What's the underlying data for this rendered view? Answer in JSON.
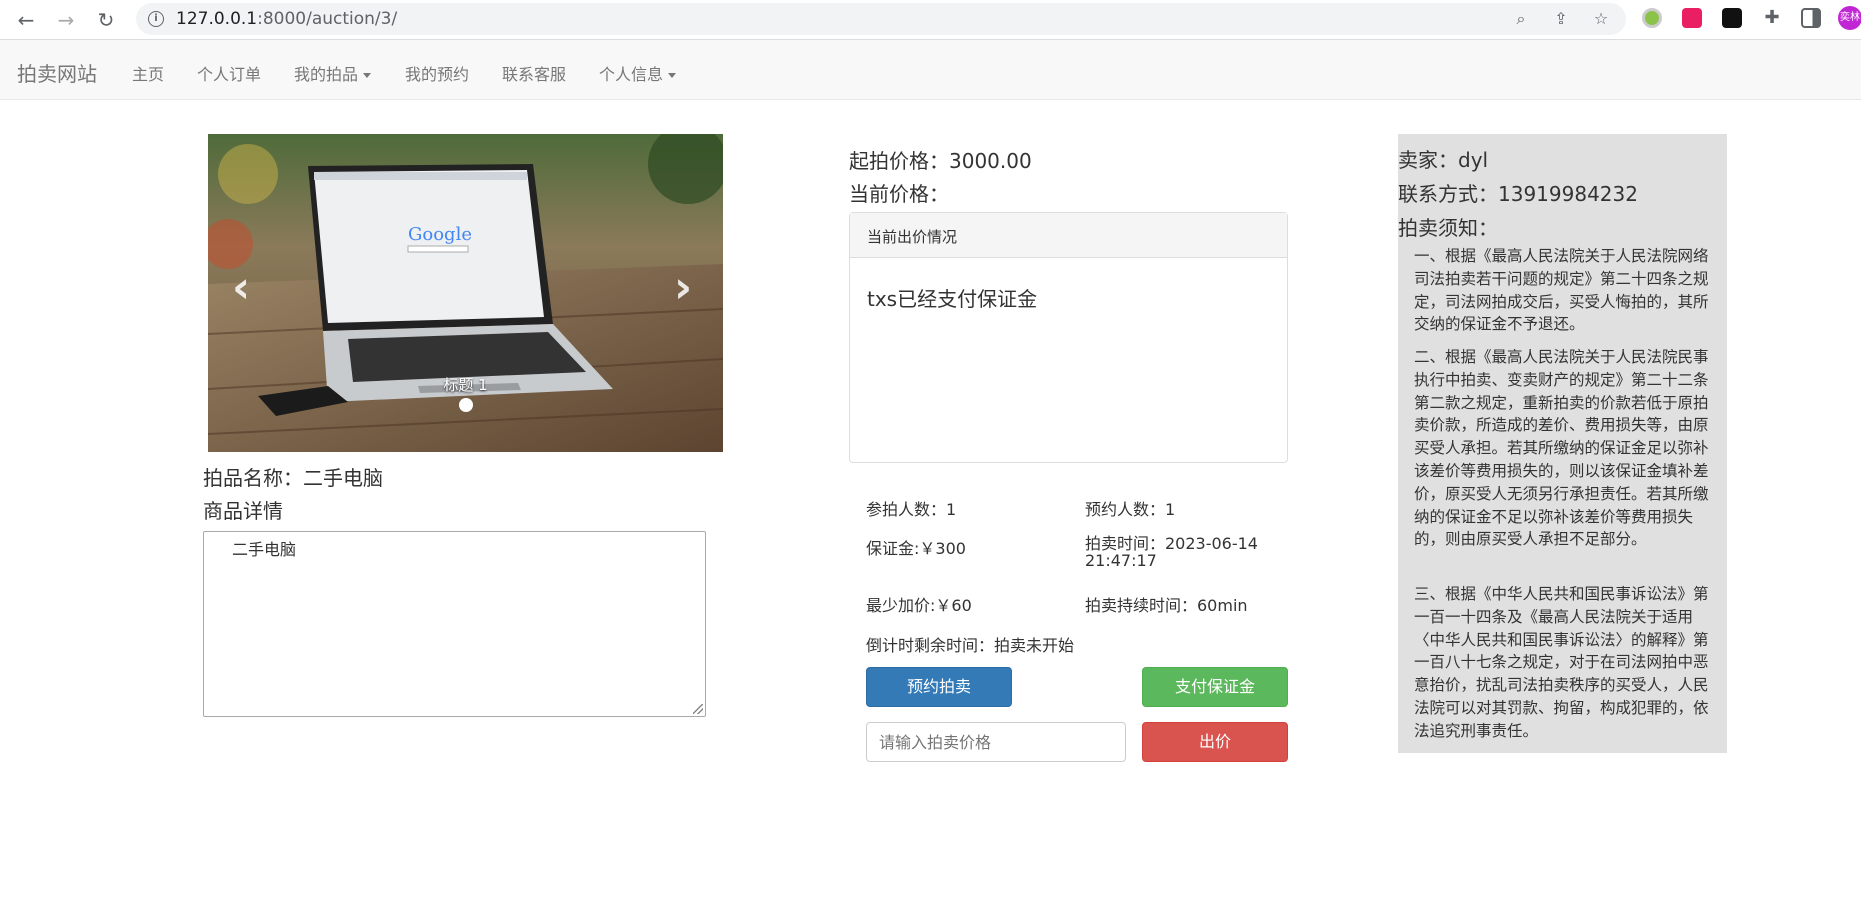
{
  "browser": {
    "url_host": "127.0.0.1",
    "url_path": ":8000/auction/3/",
    "profile_text": "奕林"
  },
  "navbar": {
    "brand": "拍卖网站",
    "items": [
      {
        "label": "主页"
      },
      {
        "label": "个人订单"
      },
      {
        "label": "我的拍品"
      },
      {
        "label": "我的预约"
      },
      {
        "label": "联系客服"
      },
      {
        "label": "个人信息"
      }
    ]
  },
  "carousel": {
    "caption": "标题 1",
    "screen_text": "Google"
  },
  "item": {
    "name_label": "拍品名称：二手电脑",
    "details_label": "商品详情",
    "details_text": "二手电脑"
  },
  "pricing": {
    "start_price": "起拍价格：3000.00",
    "current_price": "当前价格："
  },
  "bid_panel": {
    "heading": "当前出价情况",
    "message": "txs已经支付保证金"
  },
  "stats": {
    "participants": "参拍人数：1",
    "reservations": "预约人数：1",
    "deposit": "保证金:￥300",
    "auction_time": "拍卖时间：2023-06-14",
    "auction_time_2": "21:47:17",
    "min_increment": "最少加价:￥60",
    "duration": "拍卖持续时间：60min",
    "countdown": "倒计时剩余时间：拍卖未开始"
  },
  "actions": {
    "reserve_label": "预约拍卖",
    "pay_deposit_label": "支付保证金",
    "bid_placeholder": "请输入拍卖价格",
    "bid_label": "出价"
  },
  "seller": {
    "seller": "卖家：dyl",
    "contact": "联系方式：13919984232",
    "rules_title": "拍卖须知：",
    "rules": [
      "一、根据《最高人民法院关于人民法院网络司法拍卖若干问题的规定》第二十四条之规定，司法网拍成交后，买受人悔拍的，其所交纳的保证金不予退还。",
      "二、根据《最高人民法院关于人民法院民事执行中拍卖、变卖财产的规定》第二十二条第二款之规定，重新拍卖的价款若低于原拍卖价款，所造成的差价、费用损失等，由原买受人承担。若其所缴纳的保证金足以弥补该差价等费用损失的，则以该保证金填补差价，原买受人无须另行承担责任。若其所缴纳的保证金不足以弥补该差价等费用损失的，则由原买受人承担不足部分。",
      "三、根据《中华人民共和国民事诉讼法》第一百一十四条及《最高人民法院关于适用〈中华人民共和国民事诉讼法〉的解释》第一百八十七条之规定，对于在司法网拍中恶意抬价，扰乱司法拍卖秩序的买受人，人民法院可以对其罚款、拘留，构成犯罪的，依法追究刑事责任。"
    ]
  }
}
